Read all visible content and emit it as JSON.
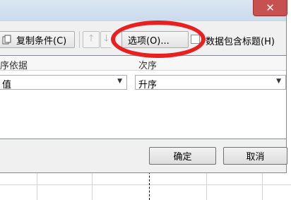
{
  "dialog": {
    "close_label": "✕",
    "toolbar": {
      "copy_condition_label": "复制条件(C)",
      "move_up_icon": "arrow-up",
      "move_down_icon": "arrow-down",
      "options_label": "选项(O)...",
      "header_checkbox_label": "数据包含标题(H)",
      "header_checkbox_checked": false
    },
    "columns": {
      "sort_by_header": "序依据",
      "order_header": "次序"
    },
    "row": {
      "sort_on_value": "值",
      "order_value": "升序"
    },
    "buttons": {
      "ok_label": "确定",
      "cancel_label": "取消"
    }
  },
  "annotation_color": "#e8201f"
}
